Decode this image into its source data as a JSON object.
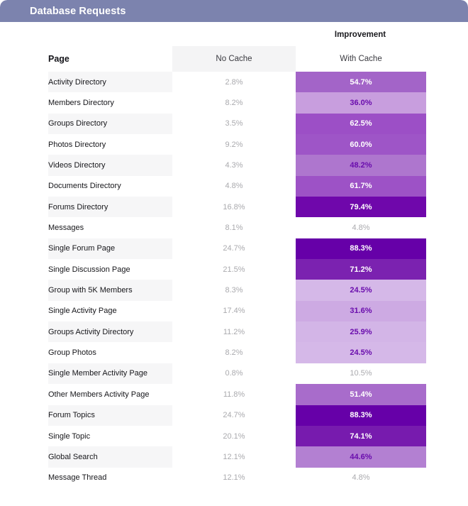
{
  "window": {
    "title": "Database Requests"
  },
  "table": {
    "group_header": "Improvement",
    "columns": {
      "page": "Page",
      "no_cache": "No Cache",
      "with_cache": "With Cache"
    }
  },
  "colors": {
    "titlebar": "#7c83ae",
    "title_text": "#ffffff",
    "header_cell_bg": "#f4f4f5",
    "stripe_bg": "#f6f6f7",
    "muted_text": "#aaaaae",
    "heat_min": "#d5b8e8",
    "heat_max": "#6600a8",
    "heat_text_light": "#ffffff",
    "heat_text_dark": "#6a0dad"
  },
  "chart_data": {
    "type": "heatmap",
    "title": "Database Requests",
    "subtitle": "Improvement",
    "xlabel": "",
    "ylabel": "Page",
    "columns": [
      "Page",
      "No Cache",
      "With Cache"
    ],
    "heat_column": "With Cache",
    "heat_range": [
      24.5,
      88.3
    ],
    "legend": "none",
    "grid": false,
    "categories": [
      "Activity Directory",
      "Members Directory",
      "Groups Directory",
      "Photos Directory",
      "Videos Directory",
      "Documents Directory",
      "Forums Directory",
      "Messages",
      "Single Forum Page",
      "Single Discussion Page",
      "Group with 5K Members",
      "Single Activity Page",
      "Groups Activity Directory",
      "Group Photos",
      "Single Member Activity Page",
      "Other Members Activity Page",
      "Forum Topics",
      "Single Topic",
      "Global Search",
      "Message Thread"
    ],
    "series": [
      {
        "name": "No Cache",
        "values": [
          2.8,
          8.2,
          3.5,
          9.2,
          4.3,
          4.8,
          16.8,
          8.1,
          24.7,
          21.5,
          8.3,
          17.4,
          11.2,
          8.2,
          0.8,
          11.8,
          24.7,
          20.1,
          12.1,
          12.1
        ]
      },
      {
        "name": "With Cache",
        "values": [
          54.7,
          36.0,
          62.5,
          60.0,
          48.2,
          61.7,
          79.4,
          4.8,
          88.3,
          71.2,
          24.5,
          31.6,
          25.9,
          24.5,
          10.5,
          51.4,
          88.3,
          74.1,
          44.6,
          4.8
        ]
      }
    ]
  },
  "rows": [
    {
      "page": "Activity Directory",
      "no_cache": "2.8%",
      "with_cache": "54.7%",
      "highlight": true,
      "bg": "#a364c8",
      "fg": "#ffffff"
    },
    {
      "page": "Members Directory",
      "no_cache": "8.2%",
      "with_cache": "36.0%",
      "highlight": true,
      "bg": "#c89ede",
      "fg": "#6a0dad"
    },
    {
      "page": "Groups Directory",
      "no_cache": "3.5%",
      "with_cache": "62.5%",
      "highlight": true,
      "bg": "#9c4fc6",
      "fg": "#ffffff"
    },
    {
      "page": "Photos Directory",
      "no_cache": "9.2%",
      "with_cache": "60.0%",
      "highlight": true,
      "bg": "#9e55c7",
      "fg": "#ffffff"
    },
    {
      "page": "Videos Directory",
      "no_cache": "4.3%",
      "with_cache": "48.2%",
      "highlight": true,
      "bg": "#ae76ce",
      "fg": "#6a0dad"
    },
    {
      "page": "Documents Directory",
      "no_cache": "4.8%",
      "with_cache": "61.7%",
      "highlight": true,
      "bg": "#9d52c6",
      "fg": "#ffffff"
    },
    {
      "page": "Forums Directory",
      "no_cache": "16.8%",
      "with_cache": "79.4%",
      "highlight": true,
      "bg": "#6f07ab",
      "fg": "#ffffff"
    },
    {
      "page": "Messages",
      "no_cache": "8.1%",
      "with_cache": "4.8%",
      "highlight": false,
      "bg": "transparent",
      "fg": "#aaaaae"
    },
    {
      "page": "Single Forum Page",
      "no_cache": "24.7%",
      "with_cache": "88.3%",
      "highlight": true,
      "bg": "#6600a8",
      "fg": "#ffffff"
    },
    {
      "page": "Single Discussion Page",
      "no_cache": "21.5%",
      "with_cache": "71.2%",
      "highlight": true,
      "bg": "#7b22b0",
      "fg": "#ffffff"
    },
    {
      "page": "Group with 5K Members",
      "no_cache": "8.3%",
      "with_cache": "24.5%",
      "highlight": true,
      "bg": "#d5b8e8",
      "fg": "#6a0dad"
    },
    {
      "page": "Single Activity Page",
      "no_cache": "17.4%",
      "with_cache": "31.6%",
      "highlight": true,
      "bg": "#cdaae3",
      "fg": "#6a0dad"
    },
    {
      "page": "Groups Activity Directory",
      "no_cache": "11.2%",
      "with_cache": "25.9%",
      "highlight": true,
      "bg": "#d3b5e7",
      "fg": "#6a0dad"
    },
    {
      "page": "Group Photos",
      "no_cache": "8.2%",
      "with_cache": "24.5%",
      "highlight": true,
      "bg": "#d5b8e8",
      "fg": "#6a0dad"
    },
    {
      "page": "Single Member Activity Page",
      "no_cache": "0.8%",
      "with_cache": "10.5%",
      "highlight": false,
      "bg": "transparent",
      "fg": "#aaaaae"
    },
    {
      "page": "Other Members Activity Page",
      "no_cache": "11.8%",
      "with_cache": "51.4%",
      "highlight": true,
      "bg": "#a86ccb",
      "fg": "#ffffff"
    },
    {
      "page": "Forum Topics",
      "no_cache": "24.7%",
      "with_cache": "88.3%",
      "highlight": true,
      "bg": "#6600a8",
      "fg": "#ffffff"
    },
    {
      "page": "Single Topic",
      "no_cache": "20.1%",
      "with_cache": "74.1%",
      "highlight": true,
      "bg": "#771bae",
      "fg": "#ffffff"
    },
    {
      "page": "Global Search",
      "no_cache": "12.1%",
      "with_cache": "44.6%",
      "highlight": true,
      "bg": "#b380d2",
      "fg": "#6a0dad"
    },
    {
      "page": "Message Thread",
      "no_cache": "12.1%",
      "with_cache": "4.8%",
      "highlight": false,
      "bg": "transparent",
      "fg": "#aaaaae"
    }
  ]
}
